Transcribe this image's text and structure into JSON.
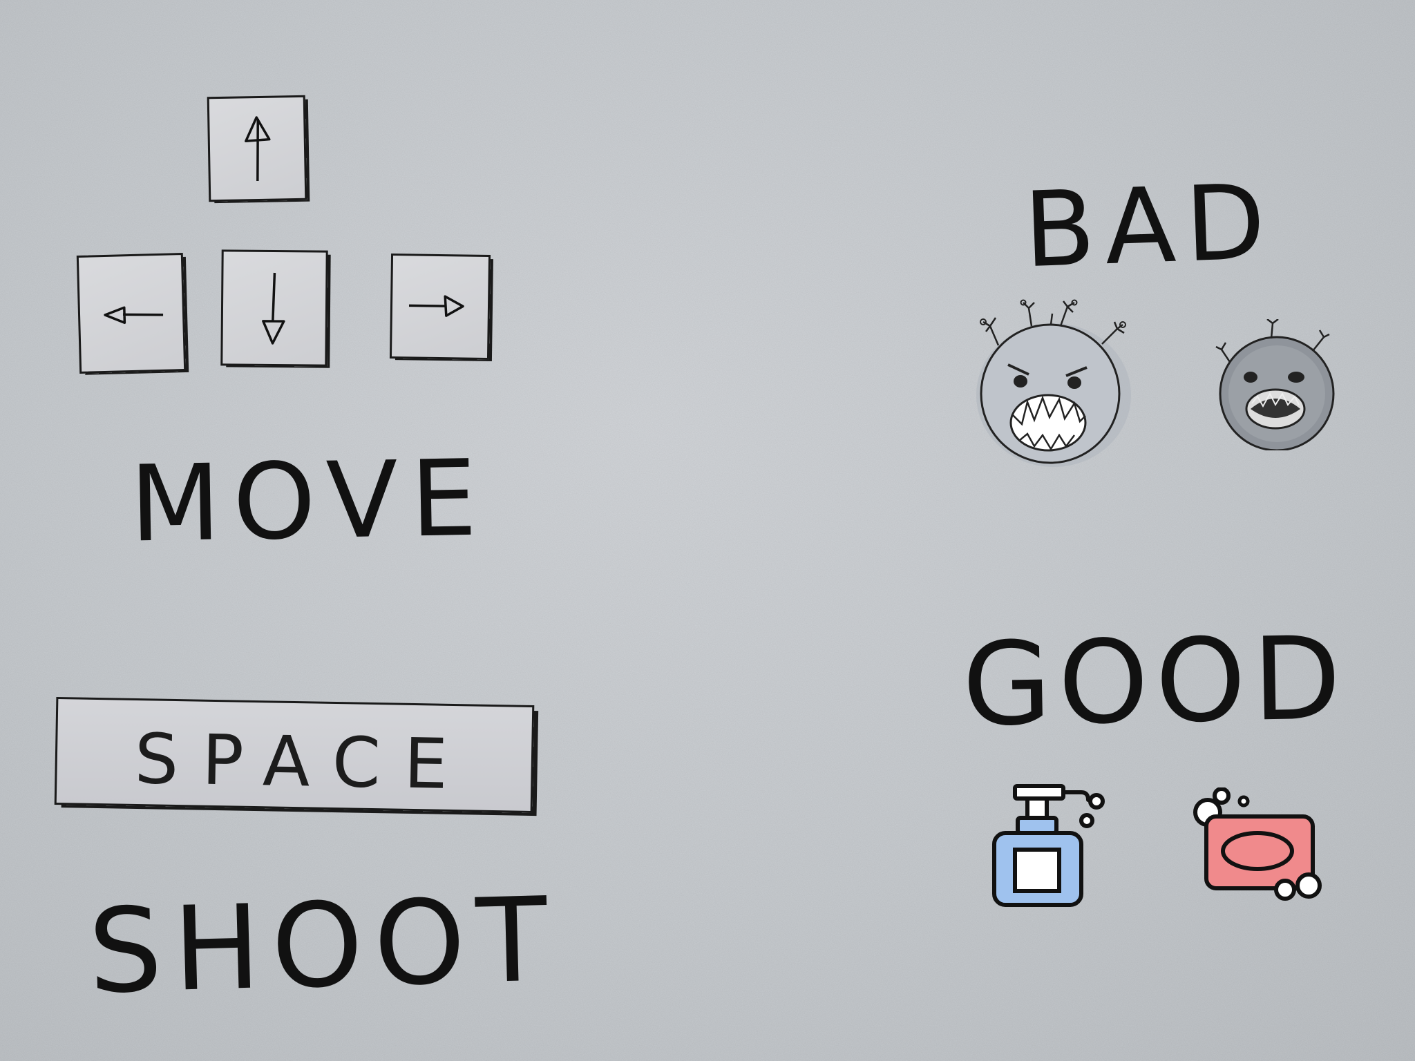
{
  "controls": {
    "move_label": "MOVE",
    "shoot_label": "SHOOT",
    "space_key_label": "SPACE",
    "arrow_keys": [
      {
        "name": "up",
        "icon": "arrow-up-icon"
      },
      {
        "name": "left",
        "icon": "arrow-left-icon"
      },
      {
        "name": "down",
        "icon": "arrow-down-icon"
      },
      {
        "name": "right",
        "icon": "arrow-right-icon"
      }
    ]
  },
  "enemies": {
    "label": "BAD",
    "sprites": [
      "angry-virus-icon",
      "dark-virus-icon"
    ]
  },
  "pickups": {
    "label": "GOOD",
    "sprites": [
      "soap-pump-bottle-icon",
      "soap-bar-icon"
    ]
  },
  "colors": {
    "ink": "#111111",
    "paper": "#c9cdd1",
    "virus_fill": "#a9aeb5",
    "soap_pump_blue": "#9fc2ee",
    "soap_bar_red": "#f08a8c"
  }
}
